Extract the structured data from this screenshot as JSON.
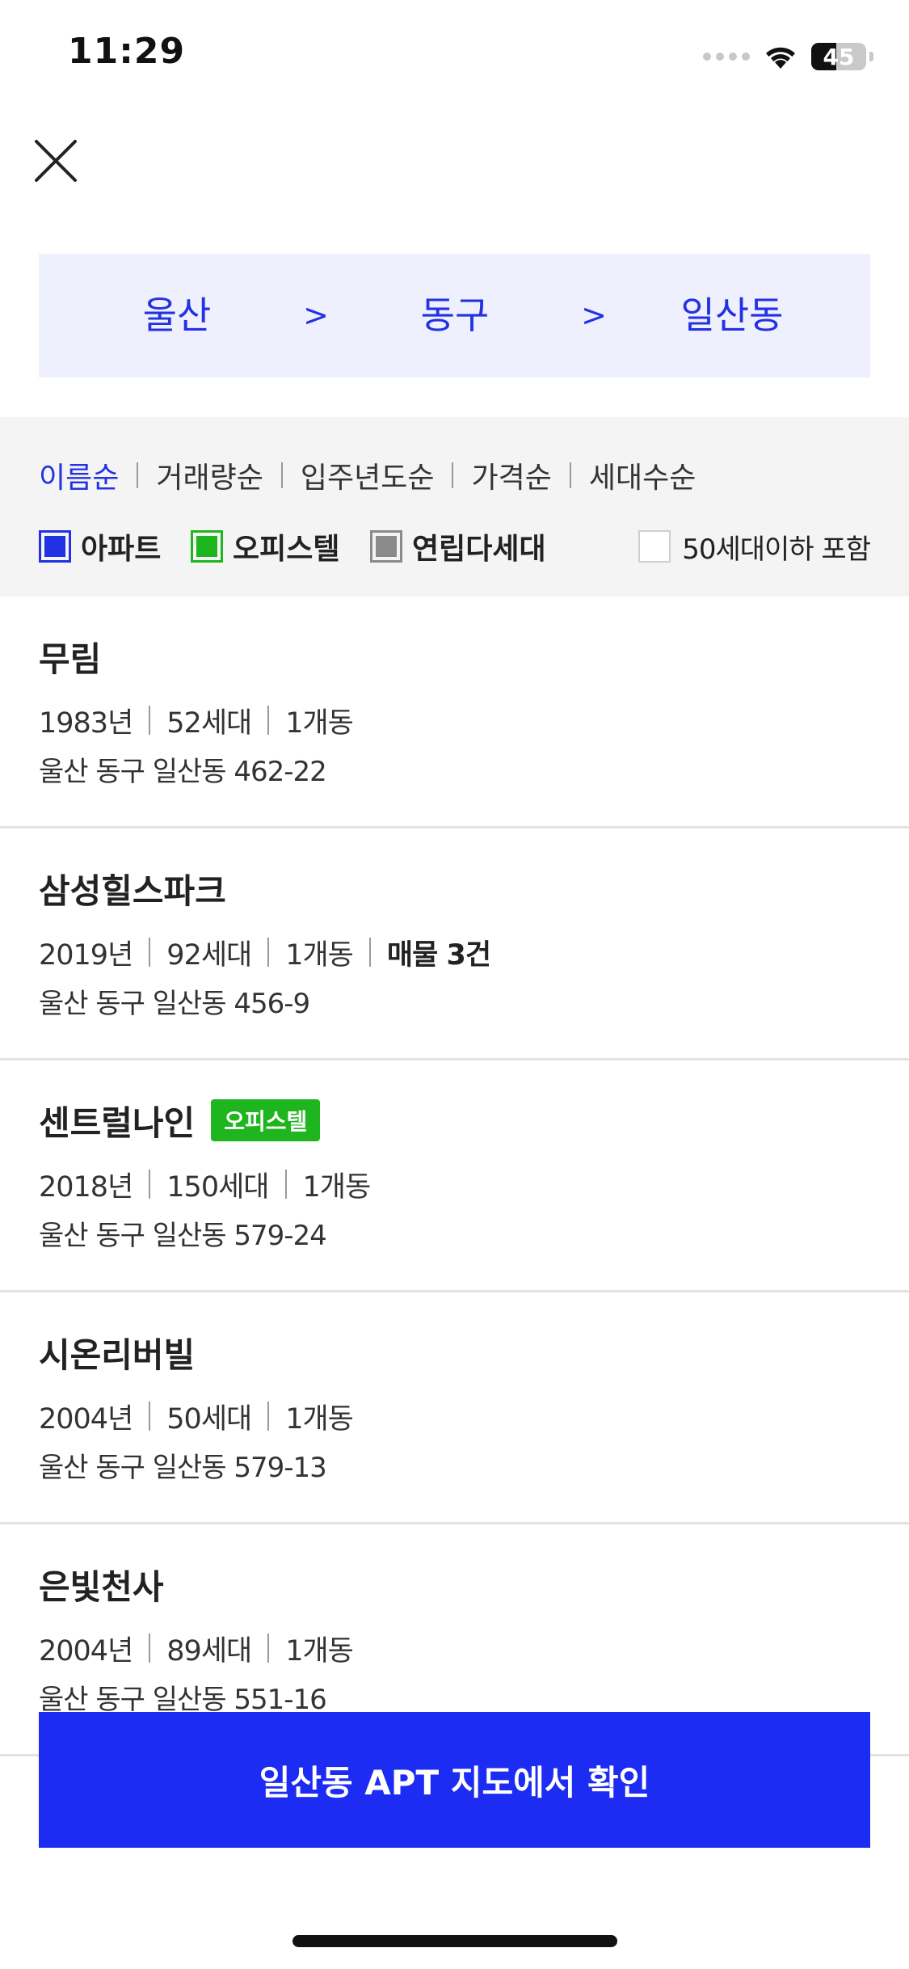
{
  "status_bar": {
    "time": "11:29",
    "battery_level": "45",
    "battery_fraction": 0.45
  },
  "breadcrumb": {
    "items": [
      "울산",
      "동구",
      "일산동"
    ],
    "separator": ">"
  },
  "sort_options": [
    {
      "label": "이름순",
      "active": true
    },
    {
      "label": "거래량순",
      "active": false
    },
    {
      "label": "입주년도순",
      "active": false
    },
    {
      "label": "가격순",
      "active": false
    },
    {
      "label": "세대수순",
      "active": false
    }
  ],
  "type_filters": [
    {
      "label": "아파트",
      "color": "#2231e3",
      "checked": true
    },
    {
      "label": "오피스텔",
      "color": "#1fb51f",
      "checked": true
    },
    {
      "label": "연립다세대",
      "color": "#8a8a8a",
      "checked": true
    }
  ],
  "small_filter": {
    "label": "50세대이하 포함",
    "checked": false
  },
  "listings": [
    {
      "name": "무림",
      "badge": "",
      "meta": [
        "1983년",
        "52세대",
        "1개동"
      ],
      "highlight": "",
      "address": "울산 동구 일산동 462-22"
    },
    {
      "name": "삼성힐스파크",
      "badge": "",
      "meta": [
        "2019년",
        "92세대",
        "1개동"
      ],
      "highlight": "매물 3건",
      "address": "울산 동구 일산동 456-9"
    },
    {
      "name": "센트럴나인",
      "badge": "오피스텔",
      "meta": [
        "2018년",
        "150세대",
        "1개동"
      ],
      "highlight": "",
      "address": "울산 동구 일산동 579-24"
    },
    {
      "name": "시온리버빌",
      "badge": "",
      "meta": [
        "2004년",
        "50세대",
        "1개동"
      ],
      "highlight": "",
      "address": "울산 동구 일산동 579-13"
    },
    {
      "name": "은빛천사",
      "badge": "",
      "meta": [
        "2004년",
        "89세대",
        "1개동"
      ],
      "highlight": "",
      "address": "울산 동구 일산동 551-16"
    }
  ],
  "cta": {
    "label": "일산동 APT 지도에서 확인"
  },
  "colors": {
    "accent": "#2231e3",
    "cta": "#1d2cf3",
    "officetel_badge": "#1fb51f"
  }
}
